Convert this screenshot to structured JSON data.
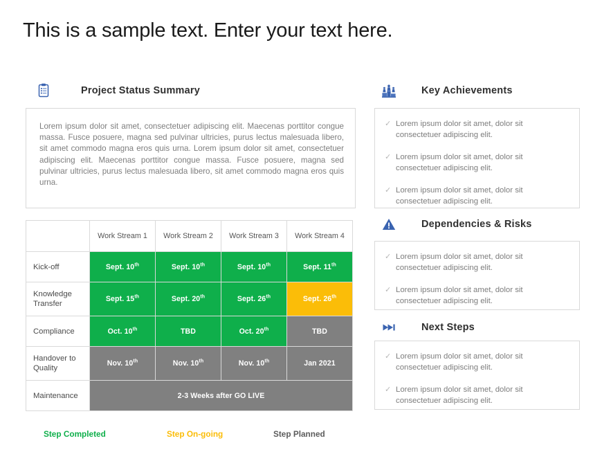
{
  "page": {
    "title": "This is a sample text. Enter your text here."
  },
  "summary": {
    "icon": "clipboard-icon",
    "heading": "Project Status Summary",
    "body": "Lorem ipsum dolor sit amet, consectetuer adipiscing elit. Maecenas porttitor congue massa. Fusce posuere, magna sed pulvinar ultricies, purus lectus malesuada libero, sit amet commodo magna eros quis urna. Lorem ipsum dolor sit amet, consectetuer adipiscing elit. Maecenas porttitor congue massa. Fusce posuere, magna sed pulvinar ultricies, purus lectus malesuada libero, sit amet commodo magna eros quis urna."
  },
  "schedule": {
    "corner_header": "",
    "columns": [
      "Work Stream 1",
      "Work Stream 2",
      "Work Stream 3",
      "Work Stream 4"
    ],
    "rows": [
      {
        "label": "Kick-off",
        "cells": [
          {
            "value": "Sept. 10",
            "suffix": "th",
            "status": "completed"
          },
          {
            "value": "Sept. 10",
            "suffix": "th",
            "status": "completed"
          },
          {
            "value": "Sept. 10",
            "suffix": "th",
            "status": "completed"
          },
          {
            "value": "Sept. 11",
            "suffix": "th",
            "status": "completed"
          }
        ]
      },
      {
        "label": "Knowledge Transfer",
        "cells": [
          {
            "value": "Sept. 15",
            "suffix": "th",
            "status": "completed"
          },
          {
            "value": "Sept. 20",
            "suffix": "th",
            "status": "completed"
          },
          {
            "value": "Sept. 26",
            "suffix": "th",
            "status": "completed"
          },
          {
            "value": "Sept. 26",
            "suffix": "th",
            "status": "ongoing"
          }
        ]
      },
      {
        "label": "Compliance",
        "cells": [
          {
            "value": "Oct. 10",
            "suffix": "th",
            "status": "completed"
          },
          {
            "value": "TBD",
            "suffix": "",
            "status": "completed"
          },
          {
            "value": "Oct. 20",
            "suffix": "th",
            "status": "completed"
          },
          {
            "value": "TBD",
            "suffix": "",
            "status": "planned"
          }
        ]
      },
      {
        "label": "Handover to Quality",
        "cells": [
          {
            "value": "Nov. 10",
            "suffix": "th",
            "status": "planned"
          },
          {
            "value": "Nov. 10",
            "suffix": "th",
            "status": "planned"
          },
          {
            "value": "Nov. 10",
            "suffix": "th",
            "status": "planned"
          },
          {
            "value": "Jan 2021",
            "suffix": "",
            "status": "planned"
          }
        ]
      },
      {
        "label": "Maintenance",
        "merged_cell": {
          "value": "2-3 Weeks after GO LIVE",
          "suffix": "",
          "status": "planned"
        }
      }
    ]
  },
  "legend": {
    "completed": "Step Completed",
    "ongoing": "Step On-going",
    "planned": "Step Planned"
  },
  "key_achievements": {
    "icon": "podium-icon",
    "heading": "Key Achievements",
    "items": [
      "Lorem ipsum dolor sit amet, dolor sit consectetuer adipiscing elit.",
      "Lorem ipsum dolor sit amet, dolor sit consectetuer adipiscing elit.",
      "Lorem ipsum dolor sit amet, dolor sit consectetuer adipiscing elit."
    ]
  },
  "dependencies_risks": {
    "icon": "warning-triangle-icon",
    "heading": "Dependencies & Risks",
    "items": [
      "Lorem ipsum dolor sit amet, dolor sit consectetuer adipiscing elit.",
      "Lorem ipsum dolor sit amet, dolor sit consectetuer adipiscing elit."
    ]
  },
  "next_steps": {
    "icon": "skip-forward-icon",
    "heading": "Next Steps",
    "items": [
      "Lorem ipsum dolor sit amet, dolor sit consectetuer adipiscing elit.",
      "Lorem ipsum dolor sit amet, dolor sit consectetuer adipiscing elit."
    ]
  },
  "colors": {
    "completed": "#0FAF4B",
    "ongoing": "#FBBD08",
    "planned": "#808080",
    "icon_blue": "#3A63B0",
    "border": "#D9D9D9",
    "body_text": "#7D7D7D"
  },
  "tick_glyph": "✓"
}
